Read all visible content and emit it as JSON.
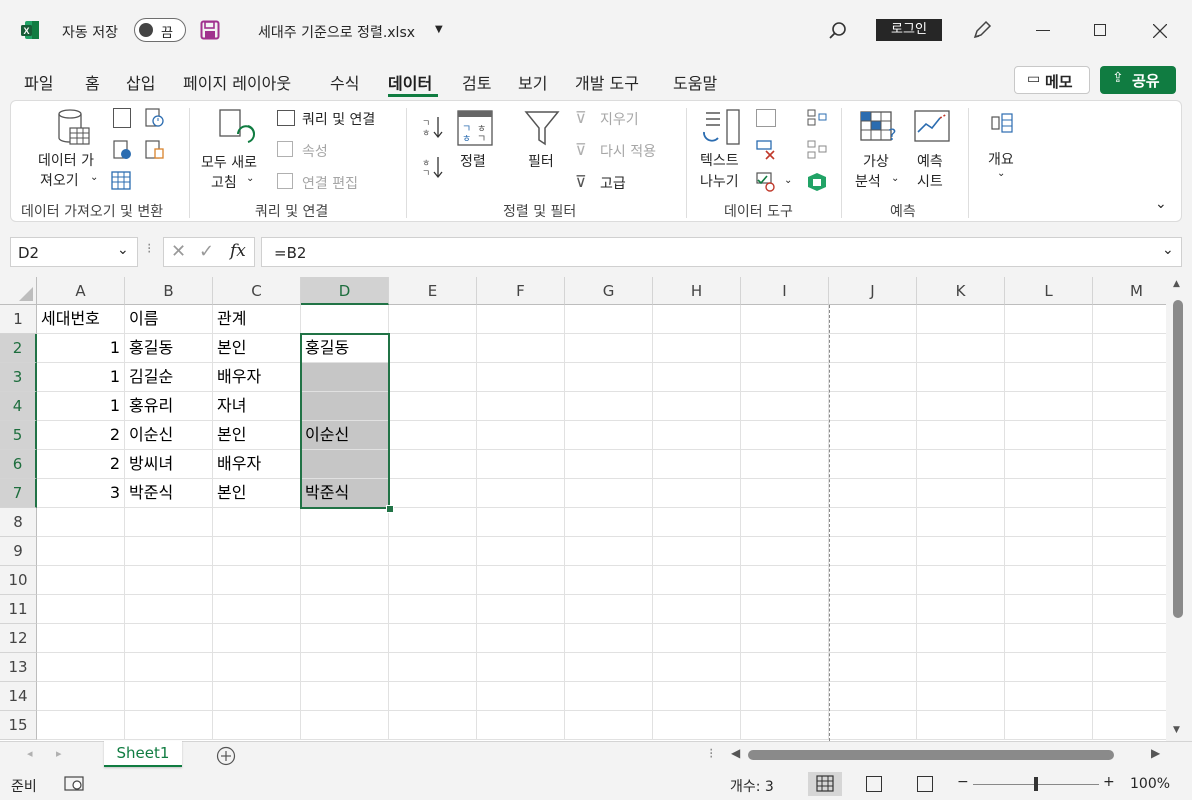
{
  "titlebar": {
    "autosave_label": "자동 저장",
    "autosave_state": "끔",
    "filename": "세대주 기준으로 정렬.xlsx",
    "login_label": "로그인"
  },
  "tabs": [
    "파일",
    "홈",
    "삽입",
    "페이지 레이아웃",
    "수식",
    "데이터",
    "검토",
    "보기",
    "개발 도구",
    "도움말"
  ],
  "active_tab": "데이터",
  "memo_label": "메모",
  "share_label": "공유",
  "ribbon": {
    "get_data_line1": "데이터 가",
    "get_data_line2": "져오기",
    "refresh_all_line1": "모두 새로",
    "refresh_all_line2": "고침",
    "queries_connections": "쿼리 및 연결",
    "properties": "속성",
    "edit_links": "연결 편집",
    "sort": "정렬",
    "filter": "필터",
    "clear": "지우기",
    "reapply": "다시 적용",
    "advanced": "고급",
    "text_to_columns_line1": "텍스트",
    "text_to_columns_line2": "나누기",
    "what_if_line1": "가상",
    "what_if_line2": "분석",
    "forecast_line1": "예측",
    "forecast_line2": "시트",
    "outline": "개요",
    "group_get_transform": "데이터 가져오기 및 변환",
    "group_queries": "쿼리 및 연결",
    "group_sort_filter": "정렬 및 필터",
    "group_data_tools": "데이터 도구",
    "group_forecast": "예측"
  },
  "formula_bar": {
    "name_box": "D2",
    "fx": "fx",
    "formula": "=B2"
  },
  "columns": [
    "A",
    "B",
    "C",
    "D",
    "E",
    "F",
    "G",
    "H",
    "I",
    "J",
    "K",
    "L",
    "M"
  ],
  "rows": [
    "1",
    "2",
    "3",
    "4",
    "5",
    "6",
    "7",
    "8",
    "9",
    "10",
    "11",
    "12",
    "13",
    "14",
    "15"
  ],
  "cells": {
    "A1": "세대번호",
    "B1": "이름",
    "C1": "관계",
    "A2": "1",
    "B2": "홍길동",
    "C2": "본인",
    "D2": "홍길동",
    "A3": "1",
    "B3": "김길순",
    "C3": "배우자",
    "A4": "1",
    "B4": "홍유리",
    "C4": "자녀",
    "A5": "2",
    "B5": "이순신",
    "C5": "본인",
    "D5": "이순신",
    "A6": "2",
    "B6": "방씨녀",
    "C6": "배우자",
    "A7": "3",
    "B7": "박준식",
    "C7": "본인",
    "D7": "박준식"
  },
  "sheet_tab": "Sheet1",
  "status": {
    "ready": "준비",
    "count_label": "개수: 3",
    "zoom": "100%"
  }
}
